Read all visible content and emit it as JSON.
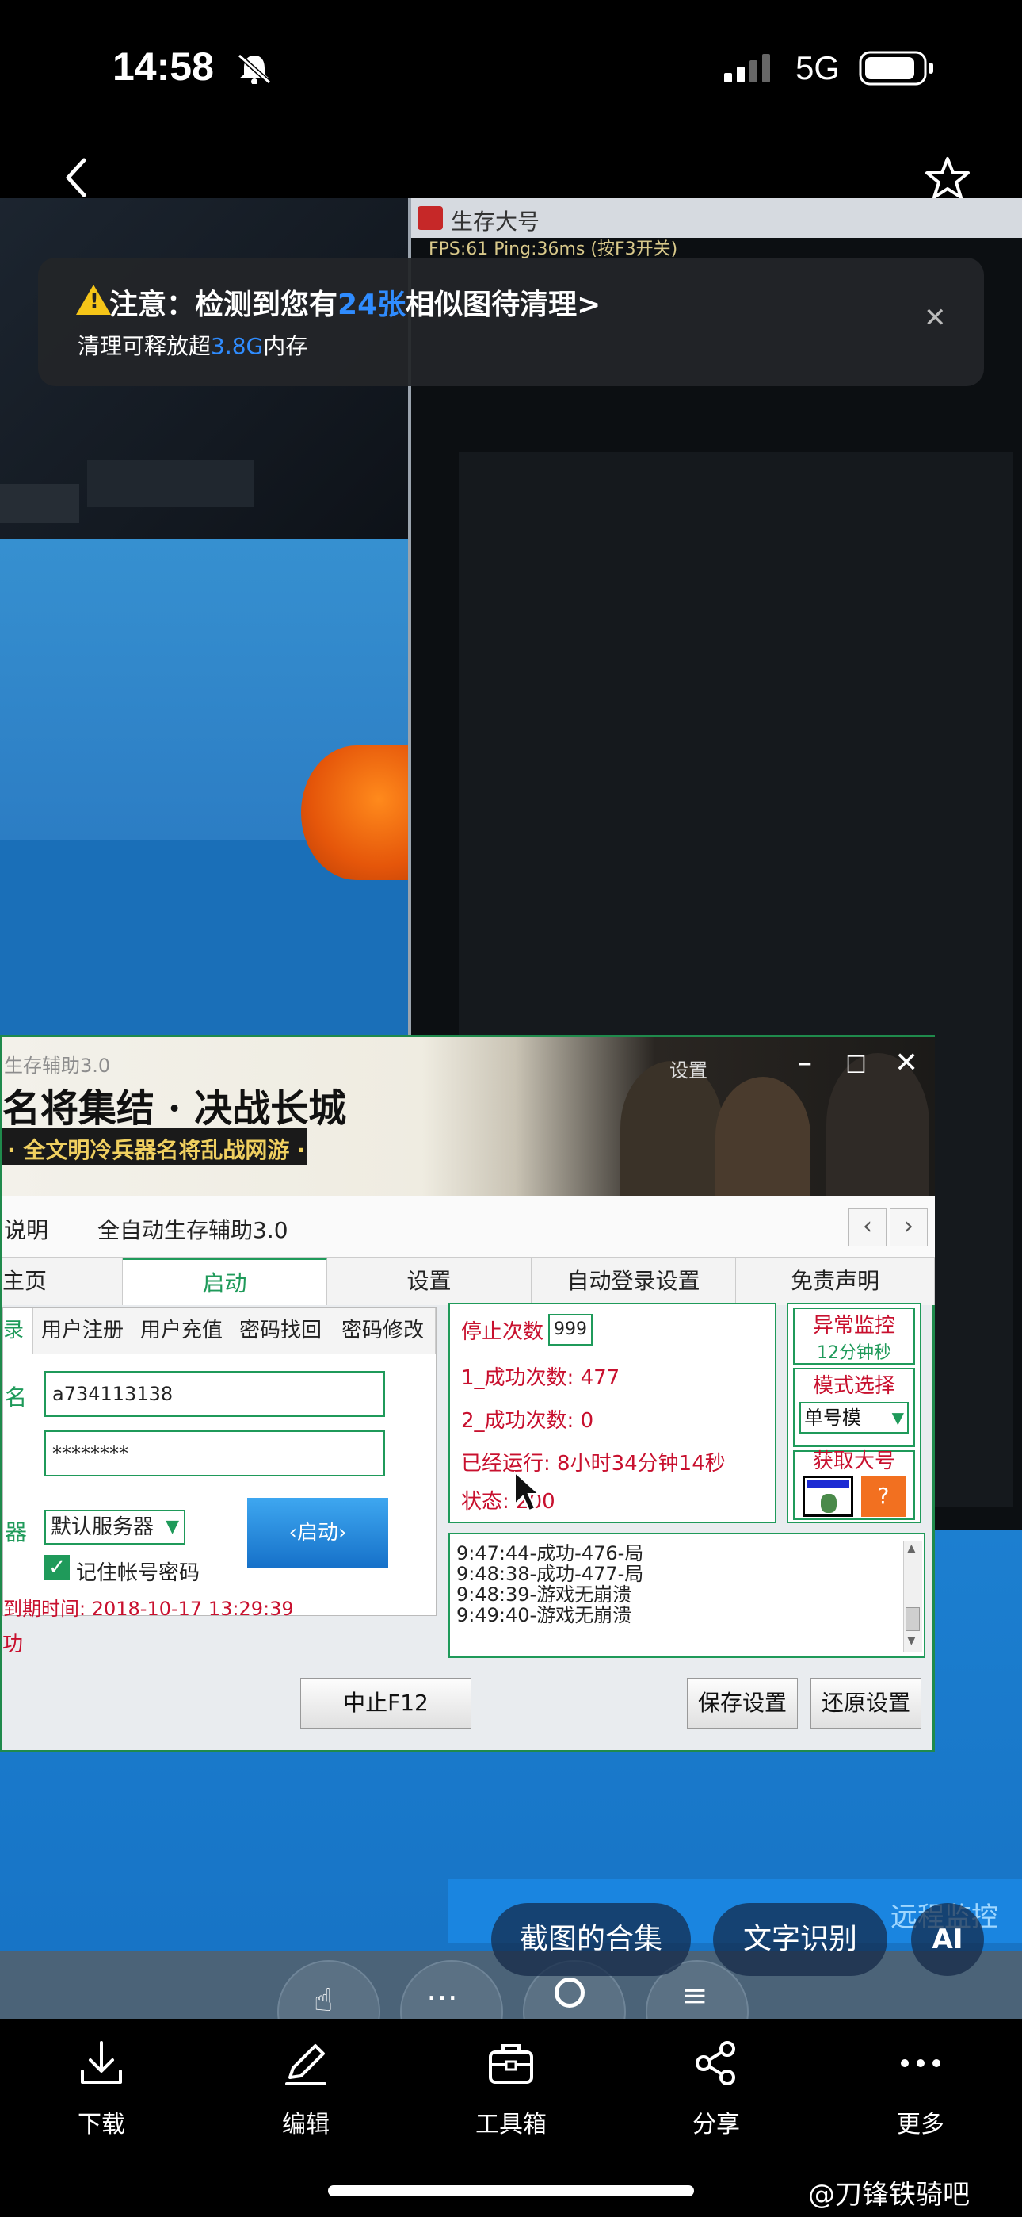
{
  "status_bar": {
    "time": "14:58",
    "network": "5G"
  },
  "nav": {
    "back_label": "back",
    "favorite_label": "favorite"
  },
  "photo": {
    "game_window": {
      "title": "生存大号",
      "fps_line": "FPS:61 Ping:36ms (按F3开关)"
    },
    "helper_window": {
      "watermark_title": "生存辅助3.0",
      "banner_title": "名将集结 · 决战长城",
      "banner_subtitle": "· 全文明冷兵器名将乱战网游 ·",
      "banner_settings": "设置",
      "menu": {
        "left": "说明",
        "center": "全自动生存辅助3.0"
      },
      "tabs": [
        "主页",
        "启动",
        "设置",
        "自动登录设置",
        "免责声明"
      ],
      "active_tab": "启动",
      "sub_tabs": [
        "录",
        "用户注册",
        "用户充值",
        "密码找回",
        "密码修改"
      ],
      "form": {
        "username_label": "名",
        "username_value": "a734113138",
        "password_value": "********",
        "server_label": "器",
        "server_value": "默认服务器",
        "start_button": "‹启动›",
        "remember_label": "记住帐号密码",
        "expire_line": "到期时间: 2018-10-17 13:29:39",
        "status_line": "功"
      },
      "stats": {
        "stop_label": "停止次数",
        "stop_value": "999",
        "success1": "1_成功次数: 477",
        "success2": "2_成功次数: 0",
        "running": "已经运行: 8小时34分钟14秒",
        "status": "状态: 200"
      },
      "side": {
        "monitor_title": "异常监控",
        "monitor_value": "12分钟秒",
        "mode_title": "模式选择",
        "mode_value": "单号模",
        "big_title": "获取大号",
        "question": "?"
      },
      "log": [
        "9:47:44-成功-476-局",
        "9:48:38-成功-477-局",
        "9:48:39-游戏无崩溃",
        "9:49:40-游戏无崩溃"
      ],
      "buttons": {
        "stop": "中止F12",
        "save": "保存设置",
        "restore": "还原设置"
      }
    },
    "remote_label": "远程监控"
  },
  "notice": {
    "line1_prefix": "注意：检测到您有",
    "line1_count": "24张",
    "line1_suffix": "相似图待清理>",
    "line2_prefix": "清理可释放超",
    "line2_size": "3.8G",
    "line2_suffix": "内存"
  },
  "chips": {
    "collection": "截图的合集",
    "ocr": "文字识别",
    "ai": "AI"
  },
  "toolbar": [
    {
      "icon": "download-icon",
      "label": "下载"
    },
    {
      "icon": "edit-icon",
      "label": "编辑"
    },
    {
      "icon": "toolbox-icon",
      "label": "工具箱"
    },
    {
      "icon": "share-icon",
      "label": "分享"
    },
    {
      "icon": "more-icon",
      "label": "更多"
    }
  ],
  "watermark": "@刀锋铁骑吧",
  "colors": {
    "accent_blue": "#2f8cff",
    "helper_green": "#1f9a5a",
    "stat_red": "#c8102e"
  }
}
